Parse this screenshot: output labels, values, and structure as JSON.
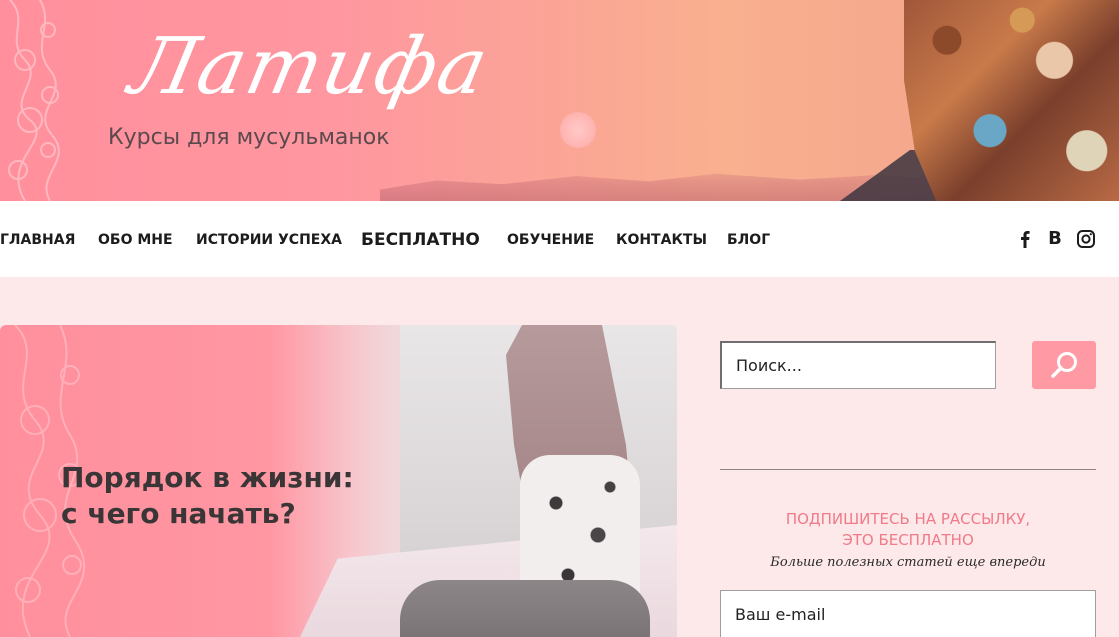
{
  "header": {
    "logo_text": "Латифа",
    "tagline": "Курсы для мусульманок"
  },
  "nav": {
    "items": [
      {
        "label": "ГЛАВНАЯ"
      },
      {
        "label": "ОБО МНЕ"
      },
      {
        "label": "ИСТОРИИ УСПЕХА"
      },
      {
        "label": "БЕСПЛАТНО"
      },
      {
        "label": "ОБУЧЕНИЕ"
      },
      {
        "label": "КОНТАКТЫ"
      },
      {
        "label": "БЛОГ"
      }
    ],
    "social": [
      {
        "icon": "facebook-icon"
      },
      {
        "icon": "vk-icon",
        "label": "B"
      },
      {
        "icon": "instagram-icon"
      }
    ]
  },
  "featured": {
    "title_line1": "Порядок в жизни:",
    "title_line2": "с чего начать?"
  },
  "sidebar": {
    "search_placeholder": "Поиск...",
    "subscribe_line1": "ПОДПИШИТЕСЬ НА РАССЫЛКУ,",
    "subscribe_line2": "ЭТО БЕСПЛАТНО",
    "subscribe_sub": "Больше полезных статей еще впереди",
    "email_placeholder": "Ваш e-mail"
  },
  "colors": {
    "brand_pink": "#ff8f9c",
    "page_bg": "#fde8ea",
    "accent_text": "#f07a87",
    "search_button": "#ff9aa4"
  }
}
